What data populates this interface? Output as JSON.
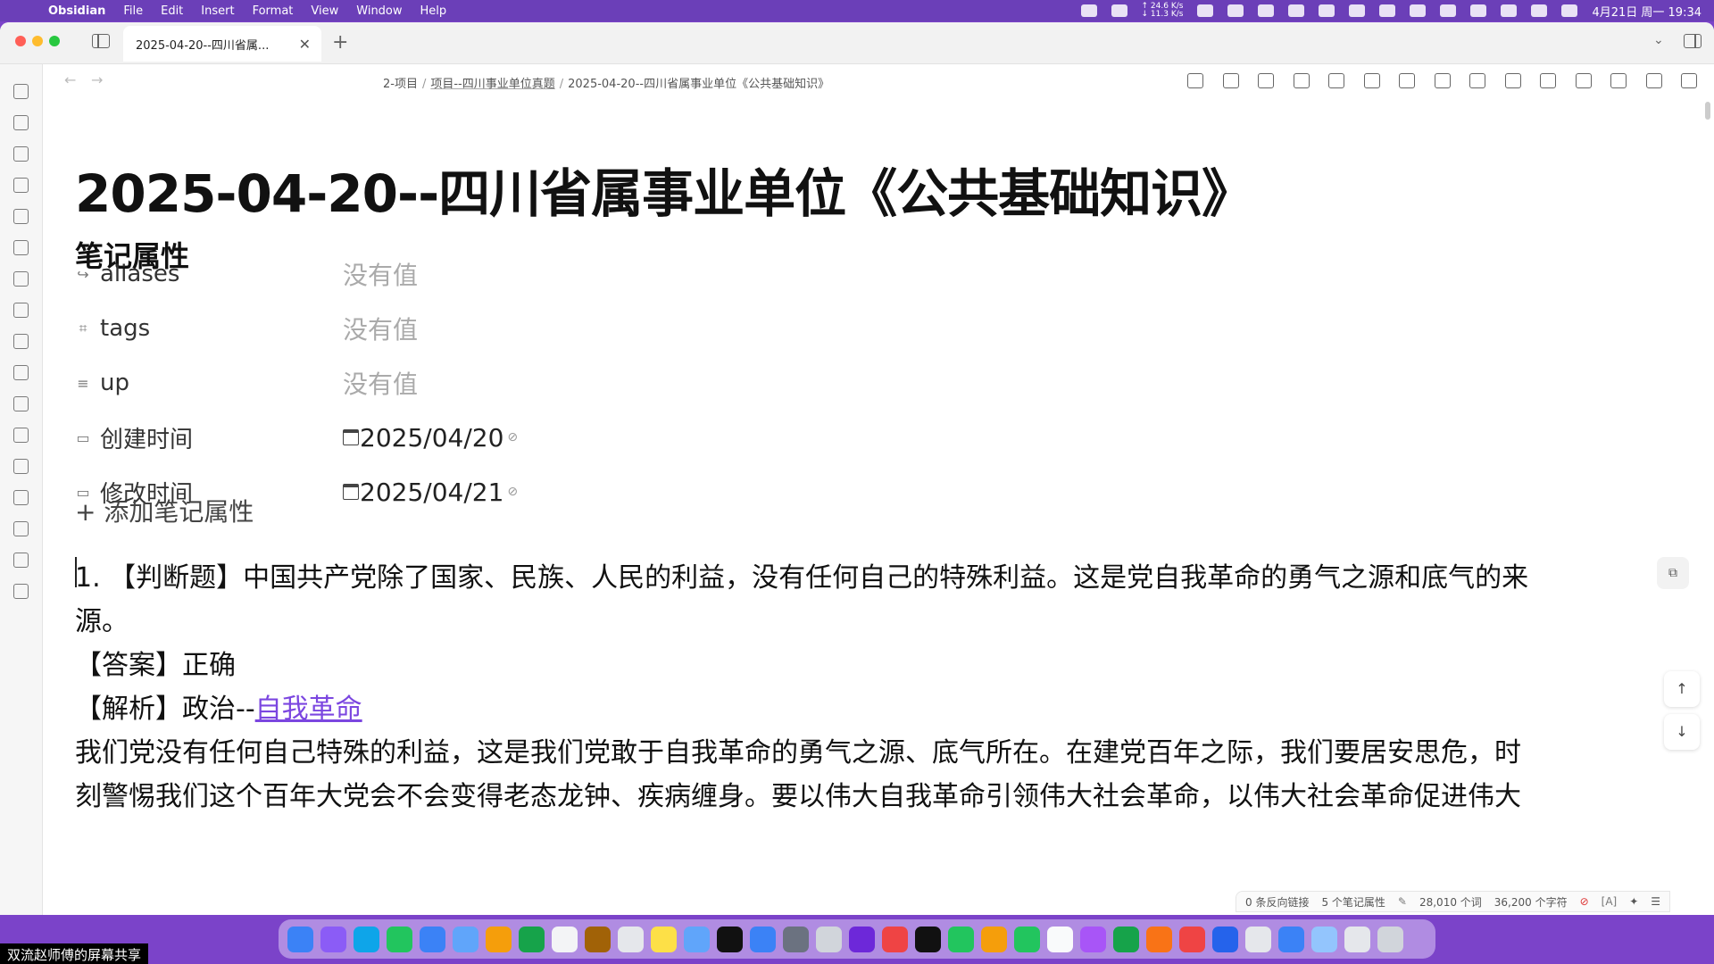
{
  "menubar": {
    "app_name": "Obsidian",
    "menus": [
      "File",
      "Edit",
      "Insert",
      "Format",
      "View",
      "Window",
      "Help"
    ],
    "net_up": "↑ 24.6 K/s",
    "net_down": "↓ 11.3 K/s",
    "clock": "4月21日 周一 19:34"
  },
  "tabbar": {
    "active_tab": "2025-04-20--四川省属...",
    "new_tab_icon": "plus-icon"
  },
  "navbar": {
    "breadcrumb": [
      "2-项目",
      "项目--四川事业单位真题",
      "2025-04-20--四川省属事业单位《公共基础知识》"
    ]
  },
  "note": {
    "title": "2025-04-20--四川省属事业单位《公共基础知识》",
    "properties_heading": "笔记属性",
    "properties": [
      {
        "icon": "↪",
        "key": "aliases",
        "value": "没有值",
        "empty": true
      },
      {
        "icon": "⌗",
        "key": "tags",
        "value": "没有值",
        "empty": true
      },
      {
        "icon": "≡",
        "key": "up",
        "value": "没有值",
        "empty": true
      },
      {
        "icon": "▭",
        "key": "创建时间",
        "value": "2025/04/20",
        "empty": false
      },
      {
        "icon": "▭",
        "key": "修改时间",
        "value": "2025/04/21",
        "empty": false
      }
    ],
    "add_property": "+ 添加笔记属性",
    "body": {
      "line1": "1. 【判断题】中国共产党除了国家、民族、人民的利益，没有任何自己的特殊利益。这是党自我革命的勇气之源和底气的来",
      "line2": "源。",
      "answer": "【答案】正确",
      "analysis_prefix": "【解析】政治--",
      "analysis_link": "自我革命",
      "line5": "我们党没有任何自己特殊的利益，这是我们党敢于自我革命的勇气之源、底气所在。在建党百年之际，我们要居安思危，时",
      "line6": "刻警惕我们这个百年大党会不会变得老态龙钟、疾病缠身。要以伟大自我革命引领伟大社会革命，以伟大社会革命促进伟大"
    }
  },
  "statusbar": {
    "backlinks": "0 条反向链接",
    "properties_count": "5 个笔记属性",
    "words": "28,010 个词",
    "chars": "36,200 个字符",
    "lang": "[A]"
  },
  "overlay": {
    "screen_share": "双流赵师傅的屏幕共享"
  },
  "colors": {
    "accent": "#7b46e0",
    "menubar": "#6b3fb8"
  }
}
